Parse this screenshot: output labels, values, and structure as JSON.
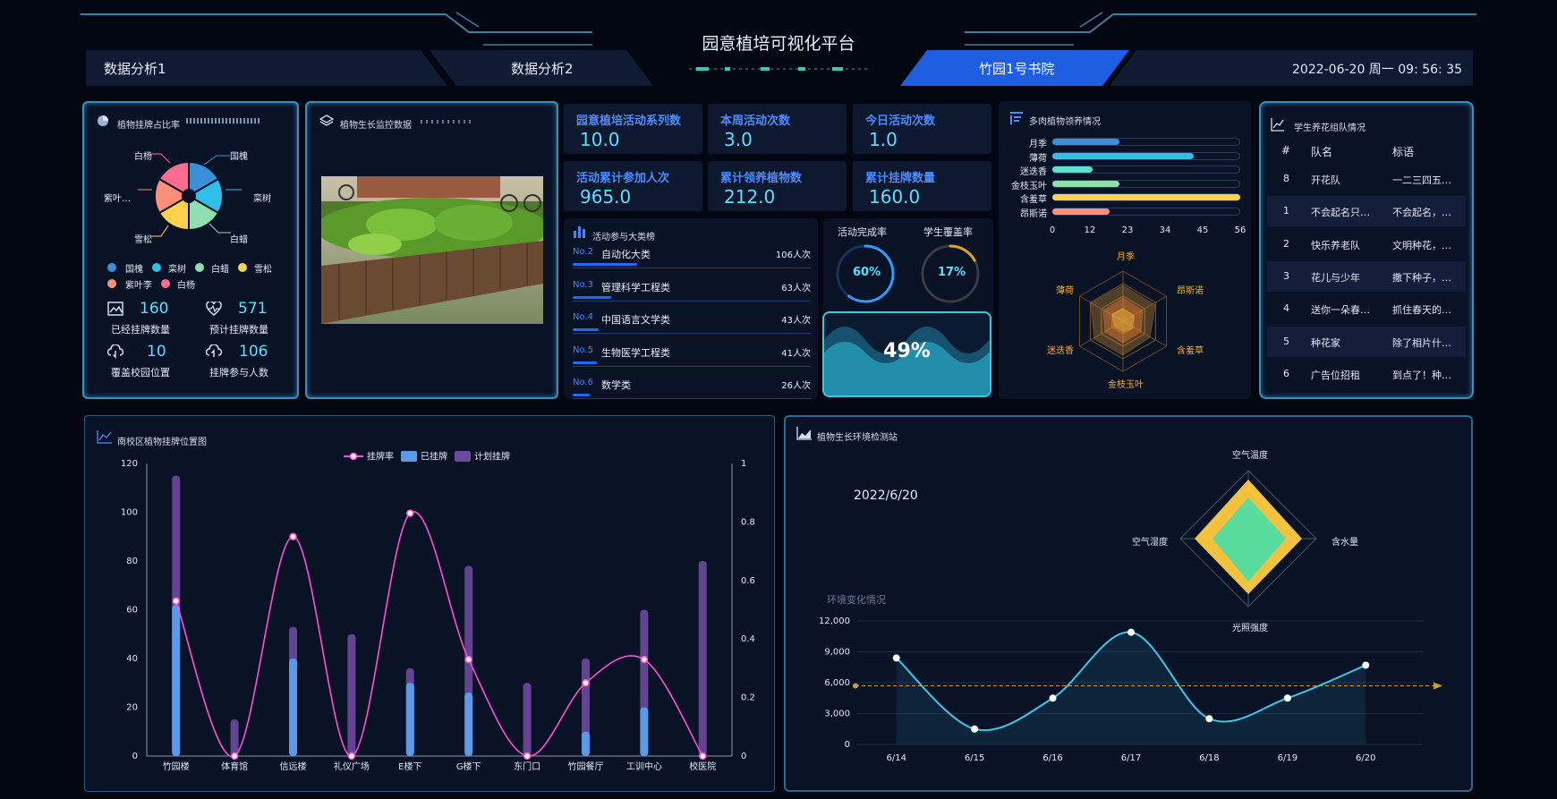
{
  "header": {
    "title": "园意植培可视化平台",
    "tab1": "数据分析1",
    "tab2": "数据分析2",
    "tab3": "竹园1号书院",
    "datetime": "2022-06-20 周一 09: 56: 35"
  },
  "colors": {
    "accent": "#1d5fe0",
    "cyan": "#58e0ff",
    "blue_label": "#4d8cff",
    "pink": "#ff4fd8",
    "purple": "#6b4a9e"
  },
  "pie_panel": {
    "title": "植物挂牌占比率",
    "labels": [
      "白杨",
      "国槐",
      "栾树",
      "白蜡",
      "雪松",
      "紫叶…"
    ],
    "legend": [
      "国槐",
      "栾树",
      "白蜡",
      "雪松",
      "紫叶李",
      "白杨"
    ],
    "legend_colors": [
      "#3a8fd8",
      "#2fbfe8",
      "#8fe0b0",
      "#ffd24a",
      "#ff8f7a",
      "#ff6b8f"
    ],
    "stats": [
      {
        "icon": "image-icon",
        "value": "160",
        "label": "已经挂牌数量"
      },
      {
        "icon": "heartbeat-icon",
        "value": "571",
        "label": "预计挂牌数量"
      },
      {
        "icon": "cloud-download-icon",
        "value": "10",
        "label": "覆盖校园位置"
      },
      {
        "icon": "cloud-upload-icon",
        "value": "106",
        "label": "挂牌参与人数"
      }
    ]
  },
  "monitor_panel": {
    "title": "植物生长监控数据"
  },
  "kpis": [
    {
      "label": "园意植培活动系列数",
      "value": "10.0"
    },
    {
      "label": "本周活动次数",
      "value": "3.0"
    },
    {
      "label": "今日活动次数",
      "value": "1.0"
    },
    {
      "label": "活动累计参加人次",
      "value": "965.0"
    },
    {
      "label": "累计领养植物数",
      "value": "212.0"
    },
    {
      "label": "累计挂牌数量",
      "value": "160.0"
    }
  ],
  "ranking": {
    "title": "活动参与大类榜",
    "rows": [
      {
        "no": "No.2",
        "name": "自动化大类",
        "count": "106人次",
        "share": 0.27
      },
      {
        "no": "No.3",
        "name": "管理科学工程类",
        "count": "63人次",
        "share": 0.16
      },
      {
        "no": "No.4",
        "name": "中国语言文学类",
        "count": "43人次",
        "share": 0.11
      },
      {
        "no": "No.5",
        "name": "生物医学工程类",
        "count": "41人次",
        "share": 0.1
      },
      {
        "no": "No.6",
        "name": "数学类",
        "count": "26人次",
        "share": 0.07
      }
    ]
  },
  "rates": {
    "completion_label": "活动完成率",
    "completion_value": "60%",
    "completion_fraction": 0.6,
    "coverage_label": "学生覆盖率",
    "coverage_value": "17%",
    "coverage_fraction": 0.17,
    "wave_value": "49%"
  },
  "succulent": {
    "title": "多肉植物领养情况",
    "names": [
      "月季",
      "薄荷",
      "迷迭香",
      "金枝玉叶",
      "含羞草",
      "昂斯诺"
    ],
    "values": [
      20,
      42,
      12,
      20,
      56,
      17
    ],
    "colors": [
      "#3a8fd8",
      "#2fbfe8",
      "#5ee0d0",
      "#8fe0b0",
      "#ffd24a",
      "#ff8f7a"
    ],
    "max": 56,
    "ticks": [
      "0",
      "12",
      "23",
      "34",
      "45",
      "56"
    ],
    "radar_labels": [
      "月季",
      "昂斯诺",
      "含羞草",
      "金枝玉叶",
      "迷迭香",
      "薄荷"
    ]
  },
  "teams": {
    "title": "学生养花组队情况",
    "col_no": "#",
    "col_name": "队名",
    "col_slogan": "标语",
    "rows": [
      {
        "no": "8",
        "name": "开花队",
        "slogan": "一二三四五…"
      },
      {
        "no": "1",
        "name": "不会起名只…",
        "slogan": "不会起名，…"
      },
      {
        "no": "2",
        "name": "快乐养老队",
        "slogan": "文明种花，…"
      },
      {
        "no": "3",
        "name": "花儿与少年",
        "slogan": "撒下种子，…"
      },
      {
        "no": "4",
        "name": "送你一朵春…",
        "slogan": "抓住春天的…"
      },
      {
        "no": "5",
        "name": "种花家",
        "slogan": "除了相片什…"
      },
      {
        "no": "6",
        "name": "广告位招租",
        "slogan": "到点了！种…"
      }
    ]
  },
  "location_chart": {
    "title": "南校区植物挂牌位置图"
  },
  "env_panel": {
    "title": "植物生长环境检测站",
    "date": "2022/6/20",
    "radar_labels": [
      "空气温度",
      "含水量",
      "光照强度",
      "空气湿度"
    ],
    "change_label": "环境变化情况"
  },
  "chart_data": [
    {
      "type": "bar",
      "title": "",
      "legend": [
        "挂牌率",
        "已挂牌",
        "计划挂牌"
      ],
      "categories": [
        "竹园楼",
        "体育馆",
        "信远楼",
        "礼仪广场",
        "E楼下",
        "G楼下",
        "东门口",
        "竹园餐厅",
        "工训中心",
        "校医院"
      ],
      "series": [
        {
          "name": "计划挂牌",
          "values": [
            115,
            15,
            53,
            50,
            36,
            78,
            30,
            40,
            60,
            80
          ]
        },
        {
          "name": "已挂牌",
          "values": [
            62,
            0,
            40,
            0,
            30,
            26,
            0,
            10,
            20,
            0
          ]
        },
        {
          "name": "挂牌率",
          "values": [
            0.53,
            0,
            0.75,
            0,
            0.83,
            0.33,
            0,
            0.25,
            0.33,
            0
          ]
        }
      ],
      "ylim": [
        0,
        120
      ],
      "y_ticks": [
        "0",
        "20",
        "40",
        "60",
        "80",
        "100",
        "120"
      ],
      "y2lim": [
        0,
        1
      ],
      "y2_ticks": [
        "0",
        "0.2",
        "0.4",
        "0.6",
        "0.8",
        "1"
      ]
    },
    {
      "type": "line",
      "title": "环境变化情况",
      "categories": [
        "6/14",
        "6/15",
        "6/16",
        "6/17",
        "6/18",
        "6/19",
        "6/20"
      ],
      "values": [
        8400,
        1500,
        4500,
        10900,
        2500,
        4500,
        7700
      ],
      "average": 5700,
      "ylim": [
        0,
        12000
      ],
      "y_ticks": [
        "0",
        "3,000",
        "6,000",
        "9,000",
        "12,000"
      ]
    }
  ]
}
